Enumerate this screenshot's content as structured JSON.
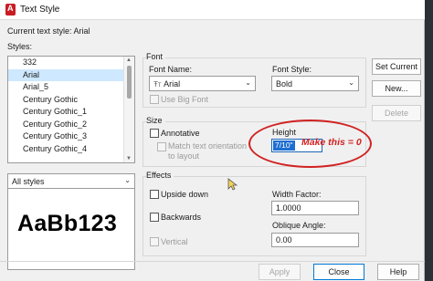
{
  "window": {
    "title": "Text Style"
  },
  "current_style": {
    "label": "Current text style:",
    "value": "Arial"
  },
  "styles": {
    "label": "Styles:",
    "items": [
      "332",
      "Arial",
      "Arial_5",
      "Century Gothic",
      "Century Gothic_1",
      "Century Gothic_2",
      "Century Gothic_3",
      "Century Gothic_4"
    ],
    "selected": "Arial",
    "filter": "All styles"
  },
  "preview": {
    "text": "AaBb123"
  },
  "font": {
    "group_label": "Font",
    "name_label": "Font Name:",
    "name_value": "Arial",
    "style_label": "Font Style:",
    "style_value": "Bold",
    "big_font_label": "Use Big Font"
  },
  "size": {
    "group_label": "Size",
    "annotative_label": "Annotative",
    "match_orientation_label": "Match text orientation to layout",
    "height_label": "Height",
    "height_value": "7/10\""
  },
  "effects": {
    "group_label": "Effects",
    "upside_down_label": "Upside down",
    "backwards_label": "Backwards",
    "vertical_label": "Vertical",
    "width_factor_label": "Width Factor:",
    "width_factor_value": "1.0000",
    "oblique_label": "Oblique Angle:",
    "oblique_value": "0.00"
  },
  "buttons": {
    "set_current": "Set Current",
    "new": "New...",
    "delete": "Delete",
    "apply": "Apply",
    "close": "Close",
    "help": "Help"
  },
  "annotation": {
    "text": "Make this = 0"
  },
  "colors": {
    "annotation": "#d12222",
    "selection": "#1e6fd0"
  }
}
